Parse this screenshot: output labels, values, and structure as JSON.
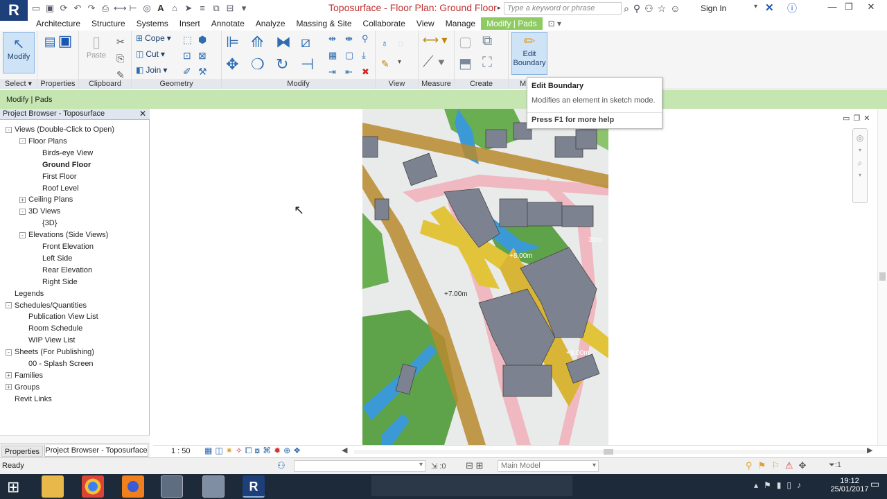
{
  "titlebar": {
    "app_logo": "R",
    "title": "Toposurface - Floor Plan: Ground Floor",
    "search_placeholder": "Type a keyword or phrase",
    "sign_in": "Sign In"
  },
  "tabs": [
    "Architecture",
    "Structure",
    "Systems",
    "Insert",
    "Annotate",
    "Analyze",
    "Massing & Site",
    "Collaborate",
    "View",
    "Manage",
    "Modify | Pads"
  ],
  "ribbon": {
    "modify_label": "Modify",
    "properties_label": "Properties",
    "paste_label": "Paste",
    "cope_label": "Cope",
    "cut_label": "Cut",
    "join_label": "Join",
    "edit_boundary_label": "Edit Boundary",
    "panels": {
      "select": "Select",
      "properties": "Properties",
      "clipboard": "Clipboard",
      "geometry": "Geometry",
      "modify": "Modify",
      "view": "View",
      "measure": "Measure",
      "create": "Create",
      "mode": "M"
    }
  },
  "context_bar": {
    "label": "Modify | Pads"
  },
  "tooltip": {
    "title": "Edit Boundary",
    "description": "Modifies an element in sketch mode.",
    "help": "Press F1 for more help"
  },
  "project_browser": {
    "title": "Project Browser - Toposurface",
    "items": [
      {
        "label": "Views (Double-Click to Open)",
        "level": 0,
        "expander": "-"
      },
      {
        "label": "Floor Plans",
        "level": 1,
        "expander": "-"
      },
      {
        "label": "Birds-eye View",
        "level": 2,
        "expander": ""
      },
      {
        "label": "Ground Floor",
        "level": 2,
        "expander": "",
        "selected": true
      },
      {
        "label": "First Floor",
        "level": 2,
        "expander": ""
      },
      {
        "label": "Roof Level",
        "level": 2,
        "expander": ""
      },
      {
        "label": "Ceiling Plans",
        "level": 1,
        "expander": "+"
      },
      {
        "label": "3D Views",
        "level": 1,
        "expander": "-"
      },
      {
        "label": "{3D}",
        "level": 2,
        "expander": ""
      },
      {
        "label": "Elevations (Side Views)",
        "level": 1,
        "expander": "-"
      },
      {
        "label": "Front Elevation",
        "level": 2,
        "expander": ""
      },
      {
        "label": "Left Side",
        "level": 2,
        "expander": ""
      },
      {
        "label": "Rear Elevation",
        "level": 2,
        "expander": ""
      },
      {
        "label": "Right Side",
        "level": 2,
        "expander": ""
      },
      {
        "label": "Legends",
        "level": 0,
        "expander": ""
      },
      {
        "label": "Schedules/Quantities",
        "level": 0,
        "expander": "-"
      },
      {
        "label": "Publication View List",
        "level": 1,
        "expander": ""
      },
      {
        "label": "Room Schedule",
        "level": 1,
        "expander": ""
      },
      {
        "label": "WIP View List",
        "level": 1,
        "expander": ""
      },
      {
        "label": "Sheets (For Publishing)",
        "level": 0,
        "expander": "-"
      },
      {
        "label": "00 - Splash Screen",
        "level": 1,
        "expander": ""
      },
      {
        "label": "Families",
        "level": 0,
        "expander": "+"
      },
      {
        "label": "Groups",
        "level": 0,
        "expander": "+"
      },
      {
        "label": "Revit Links",
        "level": 0,
        "expander": ""
      }
    ]
  },
  "map": {
    "labels": [
      "+8.00m",
      "+7.00m",
      "+8.00m",
      "30m"
    ]
  },
  "bottom_tabs": {
    "properties": "Properties",
    "project_browser": "Project Browser - Toposurface"
  },
  "viewbar": {
    "scale": "1 : 50"
  },
  "statusbar": {
    "status": "Ready",
    "filter_count": ":0",
    "model": "Main Model",
    "selection_count": ":1"
  },
  "taskbar": {
    "time": "19:12",
    "date": "25/01/2017"
  }
}
